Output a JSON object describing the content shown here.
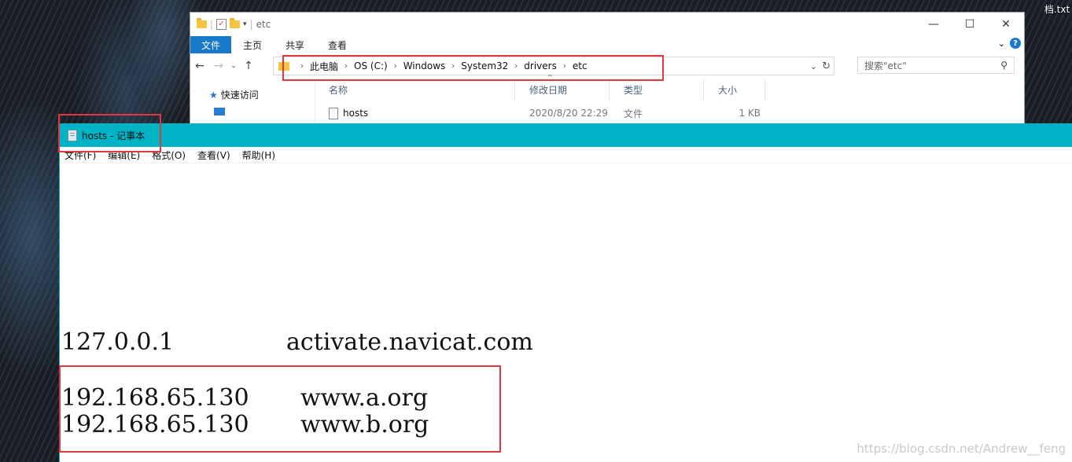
{
  "desktop": {
    "file_label": "档.txt"
  },
  "explorer": {
    "title": "etc",
    "window_controls": {
      "minimize": "—",
      "maximize": "☐",
      "close": "✕"
    },
    "ribbon_tabs": [
      "文件",
      "主页",
      "共享",
      "查看"
    ],
    "address_path": [
      "此电脑",
      "OS (C:)",
      "Windows",
      "System32",
      "drivers",
      "etc"
    ],
    "search_placeholder": "搜索\"etc\"",
    "nav_pane": {
      "quick_access": "快速访问",
      "desktop": "桌面"
    },
    "columns": [
      "名称",
      "修改日期",
      "类型",
      "大小"
    ],
    "files": [
      {
        "name": "hosts",
        "modified": "2020/8/20 22:29",
        "type": "文件",
        "size": "1 KB"
      }
    ]
  },
  "notepad": {
    "title": "hosts - 记事本",
    "menu": [
      "文件(F)",
      "编辑(E)",
      "格式(O)",
      "查看(V)",
      "帮助(H)"
    ],
    "entries": [
      {
        "ip": "127.0.0.1",
        "host": "activate.navicat.com"
      },
      {
        "ip": "192.168.65.130",
        "host": "www.a.org"
      },
      {
        "ip": "192.168.65.130",
        "host": "www.b.org"
      }
    ]
  },
  "watermark": "https://blog.csdn.net/Andrew__feng",
  "colors": {
    "accent_teal": "#00b4c5",
    "highlight_red": "#e0383e",
    "file_tab_blue": "#1979ca"
  }
}
